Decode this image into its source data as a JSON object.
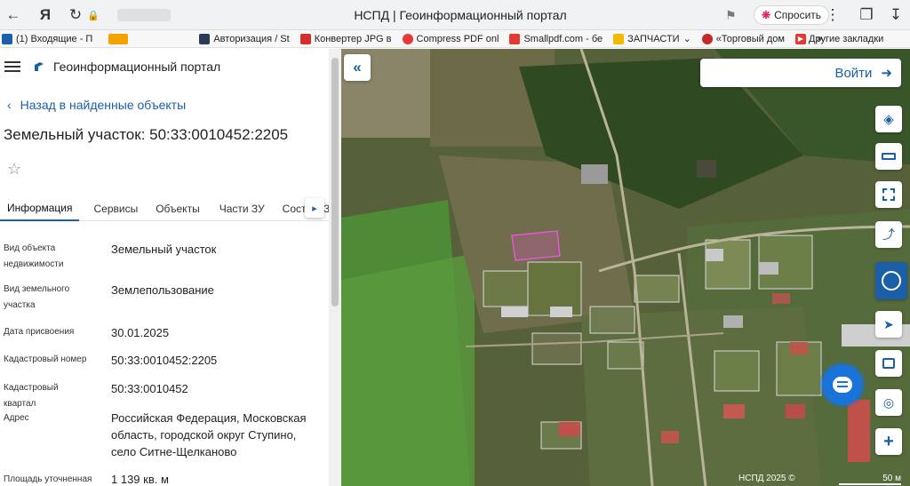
{
  "browser": {
    "page_title": "НСПД | Геоинформационный портал",
    "ask_label": "Спросить"
  },
  "bookmarks": [
    {
      "label": "(1) Входящие - П",
      "color": "#1a5fa8"
    },
    {
      "label": "",
      "color": "#f3a200"
    },
    {
      "label": "Авторизация / St",
      "color": "#2b3a55"
    },
    {
      "label": "Конвертер JPG в",
      "color": "#d32f2f"
    },
    {
      "label": "Compress PDF onl",
      "color": "#e53935"
    },
    {
      "label": "Smallpdf.com - бе",
      "color": "#e53935"
    },
    {
      "label": "ЗАПЧАСТИ",
      "color": "#f3b900"
    },
    {
      "label": "«Торговый дом",
      "color": "#c62828"
    },
    {
      "label": "",
      "color": "#e53935"
    }
  ],
  "bookmarks_more": "»",
  "other_bookmarks": "Другие закладки",
  "portal": {
    "name": "Геоинформационный портал",
    "back_label": "Назад в найденные объекты",
    "parcel_title": "Земельный участок: 50:33:0010452:2205"
  },
  "tabs": [
    {
      "label": "Информация",
      "active": true
    },
    {
      "label": "Сервисы",
      "active": false
    },
    {
      "label": "Объекты",
      "active": false
    },
    {
      "label": "Части ЗУ",
      "active": false
    },
    {
      "label": "Сост",
      "active": false
    }
  ],
  "tab_overflow": "З",
  "info_rows": [
    {
      "label": "Вид объекта недвижимости",
      "value": "Земельный участок"
    },
    {
      "label": "Вид земельного участка",
      "value": "Землепользование"
    },
    {
      "label": "Дата присвоения",
      "value": "30.01.2025"
    },
    {
      "label": "Кадастровый номер",
      "value": "50:33:0010452:2205"
    },
    {
      "label": "Кадастровый квартал",
      "value": "50:33:0010452"
    },
    {
      "label": "Адрес",
      "value": "Российская Федерация, Московская область, городской округ Ступино, село Ситне-Щелканово"
    },
    {
      "label": "Площадь уточненная",
      "value": "1 139 кв. м"
    }
  ],
  "map": {
    "login_label": "Войти",
    "copyright": "НСПД 2025 ©",
    "scale_label": "50 м",
    "tools": [
      "layers-icon",
      "ruler-icon",
      "select-area-icon",
      "share-icon",
      "nspd-logo-icon",
      "locate-icon",
      "print-icon",
      "search-location-icon",
      "zoom-in-icon"
    ]
  }
}
